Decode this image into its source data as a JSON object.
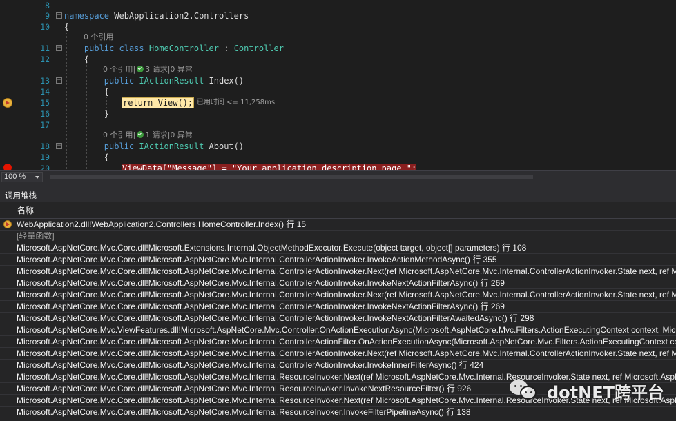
{
  "editor": {
    "lines": [
      {
        "num": "8",
        "code": ""
      },
      {
        "num": "9",
        "code": "namespace WebApplication2.Controllers"
      },
      {
        "num": "10",
        "code": "{"
      },
      {
        "num": "",
        "lens": "0 个引用"
      },
      {
        "num": "11",
        "code": "    public class HomeController : Controller"
      },
      {
        "num": "12",
        "code": "    {"
      },
      {
        "num": "",
        "lens_a": "0 个引用|",
        "lens_b": "3 请求|0 异常"
      },
      {
        "num": "13",
        "code": "        public IActionResult Index()"
      },
      {
        "num": "14",
        "code": "        {"
      },
      {
        "num": "15",
        "code": "return View();"
      },
      {
        "num": "16",
        "code": "        }"
      },
      {
        "num": "17",
        "code": ""
      },
      {
        "num": "",
        "lens_a": "0 个引用|",
        "lens_b": "1 请求|0 异常"
      },
      {
        "num": "18",
        "code": "        public IActionResult About()"
      },
      {
        "num": "19",
        "code": "        {"
      },
      {
        "num": "20",
        "code": "ViewData[\"Message\"] = \"Your application description page.\";"
      }
    ],
    "elapsed_hint": "已用时间 <= 11,258ms"
  },
  "zoom": {
    "value": "100 %"
  },
  "callstack": {
    "title": "调用堆栈",
    "column_name": "名称",
    "frames": [
      {
        "text": "WebApplication2.dll!WebApplication2.Controllers.HomeController.Index() 行 15",
        "current": true
      },
      {
        "text": "[轻量函数]",
        "external": true
      },
      {
        "text": "Microsoft.AspNetCore.Mvc.Core.dll!Microsoft.Extensions.Internal.ObjectMethodExecutor.Execute(object target, object[] parameters) 行 108"
      },
      {
        "text": "Microsoft.AspNetCore.Mvc.Core.dll!Microsoft.AspNetCore.Mvc.Internal.ControllerActionInvoker.InvokeActionMethodAsync() 行 355"
      },
      {
        "text": "Microsoft.AspNetCore.Mvc.Core.dll!Microsoft.AspNetCore.Mvc.Internal.ControllerActionInvoker.Next(ref Microsoft.AspNetCore.Mvc.Internal.ControllerActionInvoker.State next, ref M"
      },
      {
        "text": "Microsoft.AspNetCore.Mvc.Core.dll!Microsoft.AspNetCore.Mvc.Internal.ControllerActionInvoker.InvokeNextActionFilterAsync() 行 269"
      },
      {
        "text": "Microsoft.AspNetCore.Mvc.Core.dll!Microsoft.AspNetCore.Mvc.Internal.ControllerActionInvoker.Next(ref Microsoft.AspNetCore.Mvc.Internal.ControllerActionInvoker.State next, ref M"
      },
      {
        "text": "Microsoft.AspNetCore.Mvc.Core.dll!Microsoft.AspNetCore.Mvc.Internal.ControllerActionInvoker.InvokeNextActionFilterAsync() 行 269"
      },
      {
        "text": "Microsoft.AspNetCore.Mvc.Core.dll!Microsoft.AspNetCore.Mvc.Internal.ControllerActionInvoker.InvokeNextActionFilterAwaitedAsync() 行 298"
      },
      {
        "text": "Microsoft.AspNetCore.Mvc.ViewFeatures.dll!Microsoft.AspNetCore.Mvc.Controller.OnActionExecutionAsync(Microsoft.AspNetCore.Mvc.Filters.ActionExecutingContext context, Micr"
      },
      {
        "text": "Microsoft.AspNetCore.Mvc.Core.dll!Microsoft.AspNetCore.Mvc.Internal.ControllerActionFilter.OnActionExecutionAsync(Microsoft.AspNetCore.Mvc.Filters.ActionExecutingContext co"
      },
      {
        "text": "Microsoft.AspNetCore.Mvc.Core.dll!Microsoft.AspNetCore.Mvc.Internal.ControllerActionInvoker.Next(ref Microsoft.AspNetCore.Mvc.Internal.ControllerActionInvoker.State next, ref M"
      },
      {
        "text": "Microsoft.AspNetCore.Mvc.Core.dll!Microsoft.AspNetCore.Mvc.Internal.ControllerActionInvoker.InvokeInnerFilterAsync() 行 424"
      },
      {
        "text": "Microsoft.AspNetCore.Mvc.Core.dll!Microsoft.AspNetCore.Mvc.Internal.ResourceInvoker.Next(ref Microsoft.AspNetCore.Mvc.Internal.ResourceInvoker.State next, ref Microsoft.AspN"
      },
      {
        "text": "Microsoft.AspNetCore.Mvc.Core.dll!Microsoft.AspNetCore.Mvc.Internal.ResourceInvoker.InvokeNextResourceFilter() 行 926"
      },
      {
        "text": "Microsoft.AspNetCore.Mvc.Core.dll!Microsoft.AspNetCore.Mvc.Internal.ResourceInvoker.Next(ref Microsoft.AspNetCore.Mvc.Internal.ResourceInvoker.State next, ref Microsoft.AspN"
      },
      {
        "text": "Microsoft.AspNetCore.Mvc.Core.dll!Microsoft.AspNetCore.Mvc.Internal.ResourceInvoker.InvokeFilterPipelineAsync() 行 138"
      }
    ]
  },
  "watermark": {
    "text": "dotNET跨平台",
    "icon": "wechat-icon"
  },
  "colors": {
    "editor_bg": "#1e1e1e",
    "keyword": "#569cd6",
    "type": "#4ec9b0",
    "string": "#d69d85",
    "line_number": "#2b91af",
    "current_statement": "#ffe8a8",
    "breakpoint": "#e51400"
  }
}
